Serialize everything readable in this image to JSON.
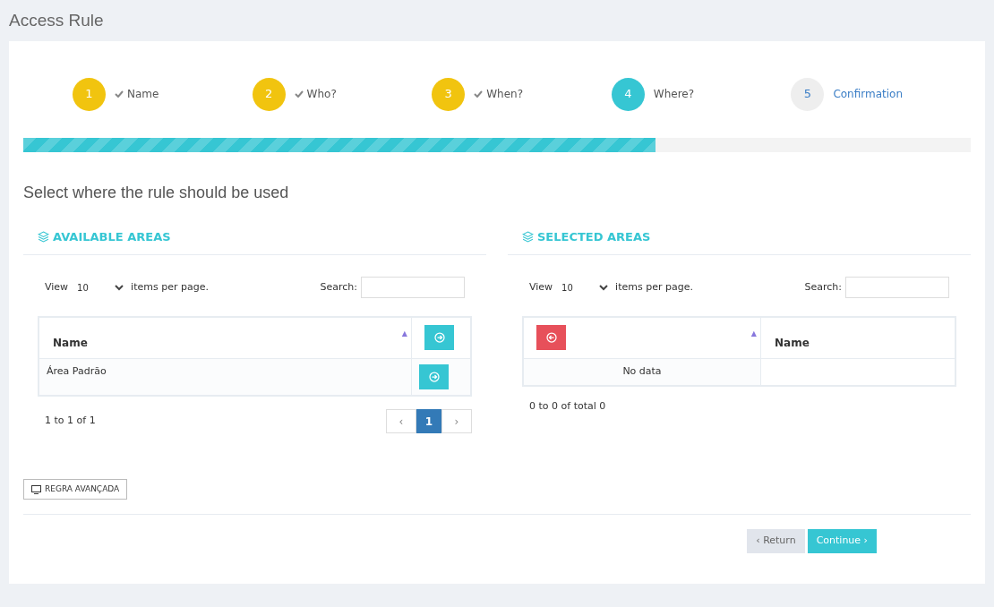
{
  "page": {
    "title": "Access Rule"
  },
  "steps": [
    {
      "number": "1",
      "label": "Name",
      "done": true,
      "current": false
    },
    {
      "number": "2",
      "label": "Who?",
      "done": true,
      "current": false
    },
    {
      "number": "3",
      "label": "When?",
      "done": true,
      "current": false
    },
    {
      "number": "4",
      "label": "Where?",
      "done": false,
      "current": true
    },
    {
      "number": "5",
      "label": "Confirmation",
      "done": false,
      "current": false
    }
  ],
  "progress": {
    "level": 0.667
  },
  "heading": "Select where the rule should be used",
  "panels": [
    {
      "title": "AVAILABLE AREAS",
      "view_label": "View",
      "per_page": "10",
      "per_page_suffix": "items per page.",
      "search_label": "Search:",
      "kind": "add",
      "name_column": "Name",
      "sort_icon": "▲",
      "rows": [
        "Área Padrão"
      ],
      "summary": "1 to 1 of 1",
      "pages": [
        {
          "label": "‹",
          "selected": false
        },
        {
          "label": "1",
          "selected": true
        },
        {
          "label": "›",
          "selected": false
        }
      ]
    },
    {
      "title": "SELECTED AREAS",
      "view_label": "View",
      "per_page": "10",
      "per_page_suffix": "items per page.",
      "search_label": "Search:",
      "kind": "remove",
      "name_column": "Name",
      "sort_icon": "▲",
      "empty_text": "No data",
      "summary": "0 to 0 of total 0"
    }
  ],
  "advanced_button": "REGRA AVANÇADA",
  "footer": {
    "return": "‹ Return",
    "continue": "Continue ›"
  }
}
